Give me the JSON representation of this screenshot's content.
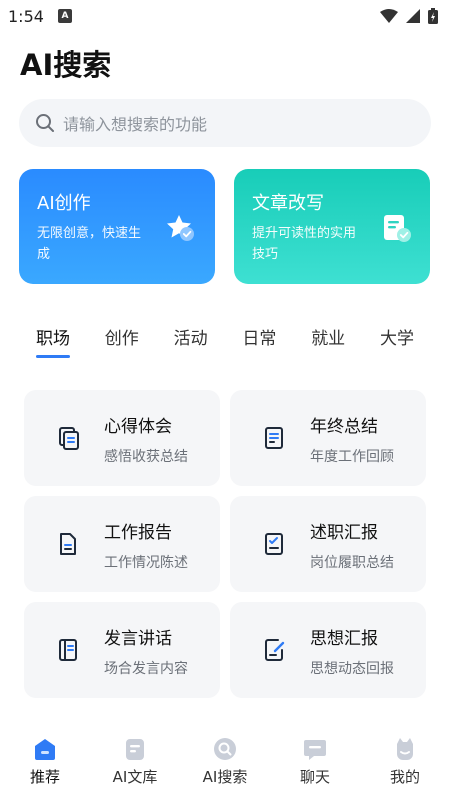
{
  "status": {
    "time": "1:54",
    "notif": "A"
  },
  "title": "AI搜索",
  "search": {
    "placeholder": "请输入想搜索的功能"
  },
  "cards": [
    {
      "title": "AI创作",
      "subtitle": "无限创意，快速生成",
      "color": "#2a8bff"
    },
    {
      "title": "文章改写",
      "subtitle": "提升可读性的实用技巧",
      "color": "#18cdb8"
    }
  ],
  "tabs": [
    "职场",
    "创作",
    "活动",
    "日常",
    "就业",
    "大学"
  ],
  "active_tab": "职场",
  "tiles": [
    {
      "title": "心得体会",
      "subtitle": "感悟收获总结",
      "icon": "documents-copy-icon"
    },
    {
      "title": "年终总结",
      "subtitle": "年度工作回顾",
      "icon": "report-icon"
    },
    {
      "title": "工作报告",
      "subtitle": "工作情况陈述",
      "icon": "document-icon"
    },
    {
      "title": "述职汇报",
      "subtitle": "岗位履职总结",
      "icon": "checklist-icon"
    },
    {
      "title": "发言讲话",
      "subtitle": "场合发言内容",
      "icon": "notebook-icon"
    },
    {
      "title": "思想汇报",
      "subtitle": "思想动态回报",
      "icon": "edit-document-icon"
    }
  ],
  "nav": [
    {
      "label": "推荐",
      "active": true
    },
    {
      "label": "AI文库",
      "active": false
    },
    {
      "label": "AI搜索",
      "active": false
    },
    {
      "label": "聊天",
      "active": false
    },
    {
      "label": "我的",
      "active": false
    }
  ],
  "colors": {
    "accent": "#2f7bf5",
    "tile_bg": "#f5f6f8",
    "icon_dark": "#1f2a3a"
  }
}
